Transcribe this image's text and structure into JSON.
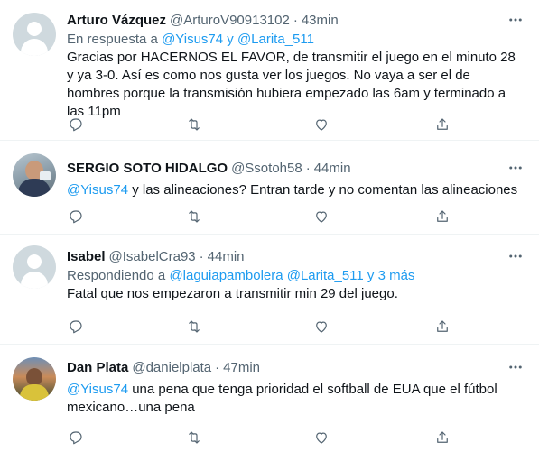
{
  "tweets": [
    {
      "name": "Arturo Vázquez",
      "handle": "@ArturoV90913102",
      "dot": "·",
      "time": "43min",
      "reply_prefix": "En respuesta a ",
      "reply_to": "@Yisus74 y @Larita_511",
      "mention": "",
      "text": "Gracias por HACERNOS EL FAVOR, de transmitir el juego en el minuto 28 y ya 3-0. Así es como nos gusta ver los juegos. No vaya a ser el de hombres porque la transmisión hubiera empezado las 6am y terminado a las 11pm",
      "avatar": "default-avatar"
    },
    {
      "name": "SERGIO SOTO HIDALGO",
      "handle": "@Ssotoh58",
      "dot": "·",
      "time": "44min",
      "reply_prefix": "",
      "reply_to": "",
      "mention": "@Yisus74",
      "text": " y las alineaciones? Entran tarde y no comentan las alineaciones",
      "avatar": "photo-avatar"
    },
    {
      "name": "Isabel",
      "handle": "@IsabelCra93",
      "dot": "·",
      "time": "44min",
      "reply_prefix": "Respondiendo a ",
      "reply_to": "@laguiapambolera @Larita_511 y 3 más",
      "mention": "",
      "text": "Fatal que nos empezaron a transmitir min 29 del juego.",
      "avatar": "default-avatar"
    },
    {
      "name": "Dan Plata",
      "handle": "@danielplata",
      "dot": "·",
      "time": "47min",
      "reply_prefix": "",
      "reply_to": "",
      "mention": "@Yisus74",
      "text": " una pena que tenga prioridad el softball de EUA que el fútbol mexicano…una pena",
      "avatar": "photo-avatar"
    }
  ],
  "icons": {
    "more": "more-horizontal-icon",
    "reply": "reply-icon",
    "retweet": "retweet-icon",
    "like": "like-icon",
    "share": "share-icon"
  },
  "colors": {
    "link": "#1d9bf0",
    "secondary_text": "#536471",
    "primary_text": "#0f1419",
    "divider": "#eff3f4"
  }
}
